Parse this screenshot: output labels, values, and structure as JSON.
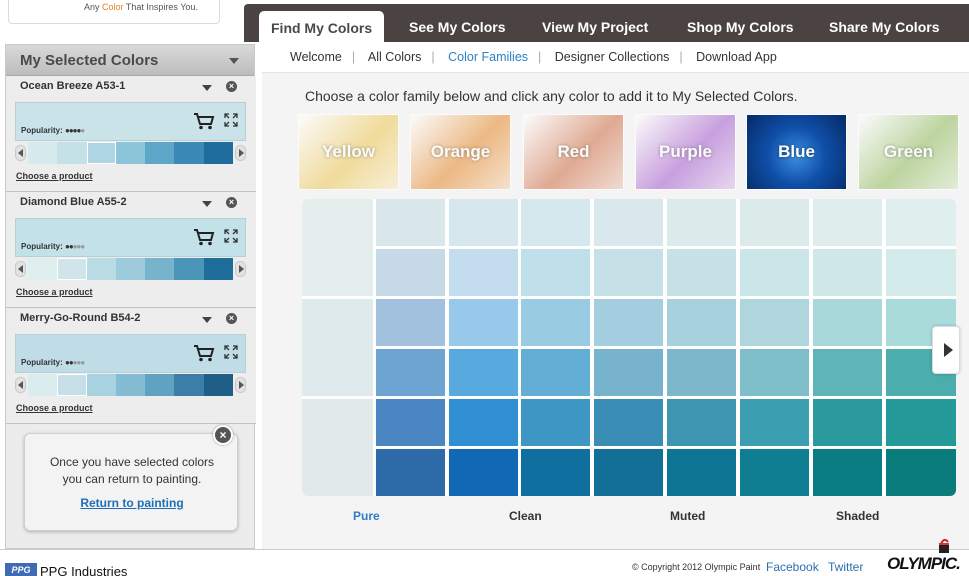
{
  "header": {
    "tagline_prefix": "Any",
    "tagline_highlight": "Color",
    "tagline_suffix": "That Inspires You."
  },
  "nav": {
    "tabs": [
      "Find My Colors",
      "See My Colors",
      "View My Project",
      "Shop My Colors",
      "Share My Colors"
    ],
    "active_tab": "Find My Colors",
    "subnav": [
      "Welcome",
      "All Colors",
      "Color Families",
      "Designer Collections",
      "Download App"
    ],
    "active_subnav": "Color Families"
  },
  "sidebar": {
    "title": "My Selected Colors",
    "popularity_label": "Popularity:",
    "choose_label": "Choose a product",
    "colors": [
      {
        "name": "Ocean Breeze A53-1",
        "popularity": 4,
        "swatch": "#c9e3e9",
        "strip": [
          "#d7ebee",
          "#c5e1e8",
          "#aed6e2",
          "#8cc4da",
          "#5ea6c8",
          "#3b89b6",
          "#1f6d9f"
        ],
        "selected_index": 2
      },
      {
        "name": "Diamond Blue A55-2",
        "popularity": 2,
        "swatch": "#c2e1e8",
        "strip": [
          "#dfeeee",
          "#cfe5ea",
          "#b9dbe4",
          "#9dcbdb",
          "#77b4cc",
          "#4a95b8",
          "#1f6e9a"
        ],
        "selected_index": 1
      },
      {
        "name": "Merry-Go-Round B54-2",
        "popularity": 2,
        "swatch": "#c0dde7",
        "strip": [
          "#d9ecee",
          "#c5e0e8",
          "#a9d2e1",
          "#84bdd3",
          "#5fa2c2",
          "#3b7fa8",
          "#1f5e87"
        ],
        "selected_index": 1
      }
    ],
    "tip": {
      "line1": "Once you have selected colors",
      "line2": "you can return to painting.",
      "link": "Return to painting"
    }
  },
  "main": {
    "instruction": "Choose a color family below and click any color to add it to My Selected Colors.",
    "families": [
      {
        "label": "Yellow",
        "color": "#f0d27a"
      },
      {
        "label": "Orange",
        "color": "#e9a259"
      },
      {
        "label": "Red",
        "color": "#d88e6e"
      },
      {
        "label": "Purple",
        "color": "#b77fd6"
      },
      {
        "label": "Blue",
        "color": "#0f4fa8"
      },
      {
        "label": "Green",
        "color": "#a8c980"
      }
    ],
    "active_family": "Blue",
    "column_labels": [
      {
        "label": "Pure",
        "active": true
      },
      {
        "label": "Clean",
        "active": false
      },
      {
        "label": "Muted",
        "active": false
      },
      {
        "label": "Shaded",
        "active": false
      }
    ],
    "grid_first_column": [
      "#e4eeed",
      "#dfeaec",
      "#e0ebe9"
    ],
    "grid_rows": [
      [
        "#d9e6ea",
        "#d6e8ee",
        "#d5e8ee",
        "#d8e8ec",
        "#dbeaea",
        "#dcebea",
        "#dfeded",
        "#e0eeee"
      ],
      [
        "#c5d9e6",
        "#c3ddee",
        "#bfdfea",
        "#c5e0e7",
        "#c7e2e6",
        "#cbe6e8",
        "#cfe7e6",
        "#d3ebea"
      ],
      [
        "#a2c1de",
        "#99c9ea",
        "#99cbe2",
        "#a4cde0",
        "#a7d1dc",
        "#aed6dc",
        "#a8d8d9",
        "#a8dbda"
      ],
      [
        "#6ea4d2",
        "#58a9de",
        "#63aed4",
        "#78b3cd",
        "#7cb7cb",
        "#7ebfc9",
        "#5fb4b7",
        "#4cadad"
      ],
      [
        "#4a87c2",
        "#2f8fd0",
        "#3d96c4",
        "#3a8eb6",
        "#3d95b2",
        "#3c9fb1",
        "#2b9a9f",
        "#239a98"
      ],
      [
        "#2c6aa8",
        "#1168b4",
        "#0f6f9f",
        "#126f98",
        "#0e7595",
        "#0f7e93",
        "#0a7c83",
        "#0a7c7b"
      ]
    ]
  },
  "footer": {
    "company": "PPG Industries",
    "logo_text": "PPG",
    "copyright": "© Copyright 2012 Olympic Paint",
    "facebook": "Facebook",
    "twitter": "Twitter",
    "brand": "OLYMPIC."
  }
}
